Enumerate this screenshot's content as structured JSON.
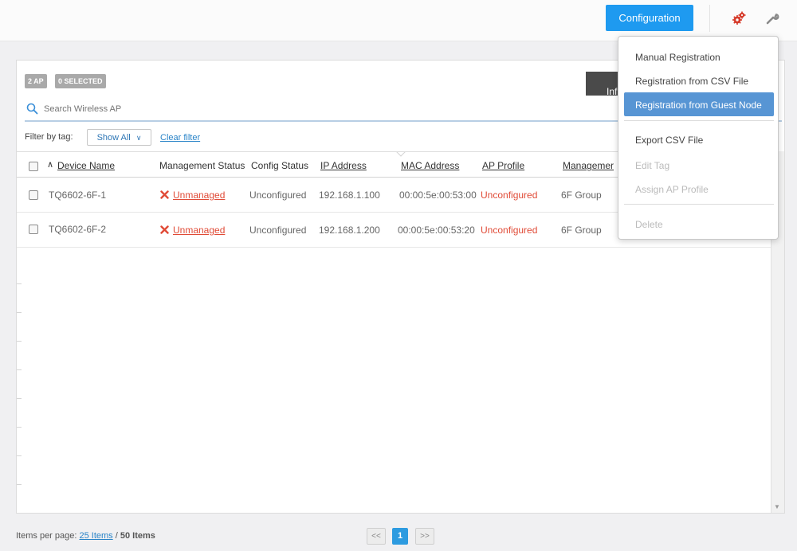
{
  "header": {
    "config_label": "Configuration",
    "icons": [
      "gears-icon",
      "wrench-icon"
    ]
  },
  "toolbar": {
    "ap_badge": "2 AP",
    "selected_badge": "0 SELECTED",
    "dark_button_label": "Inf"
  },
  "search": {
    "placeholder": "Search Wireless AP"
  },
  "filter": {
    "label": "Filter by tag:",
    "show_all": "Show All",
    "clear": "Clear filter"
  },
  "table": {
    "columns": [
      "Device Name",
      "Management Status",
      "Config Status",
      "IP Address",
      "MAC Address",
      "AP Profile",
      "Managemer"
    ],
    "rows": [
      {
        "device": "TQ6602-6F-1",
        "status": "Unmanaged",
        "config": "Unconfigured",
        "ip": "192.168.1.100",
        "mac": "00:00:5e:00:53:00",
        "profile": "Unconfigured",
        "group": "6F Group"
      },
      {
        "device": "TQ6602-6F-2",
        "status": "Unmanaged",
        "config": "Unconfigured",
        "ip": "192.168.1.200",
        "mac": "00:00:5e:00:53:20",
        "profile": "Unconfigured",
        "group": "6F Group"
      }
    ]
  },
  "footer": {
    "per_page_label": "Items per page:",
    "per_page_value": "25 Items",
    "separator": "/",
    "total": "50 Items",
    "prev": "<<",
    "page": "1",
    "next": ">>"
  },
  "menu": {
    "items": [
      {
        "label": "Manual Registration",
        "state": "normal"
      },
      {
        "label": "Registration from CSV File",
        "state": "normal"
      },
      {
        "label": "Registration from Guest Node",
        "state": "active"
      },
      {
        "label": "Export CSV File",
        "state": "normal"
      },
      {
        "label": "Edit Tag",
        "state": "disabled"
      },
      {
        "label": "Assign AP Profile",
        "state": "disabled"
      },
      {
        "label": "Delete",
        "state": "disabled"
      }
    ]
  },
  "colors": {
    "accent": "#1e9af0",
    "danger": "#e04a36",
    "menu_active": "#5795d4",
    "link": "#2a84c8"
  }
}
